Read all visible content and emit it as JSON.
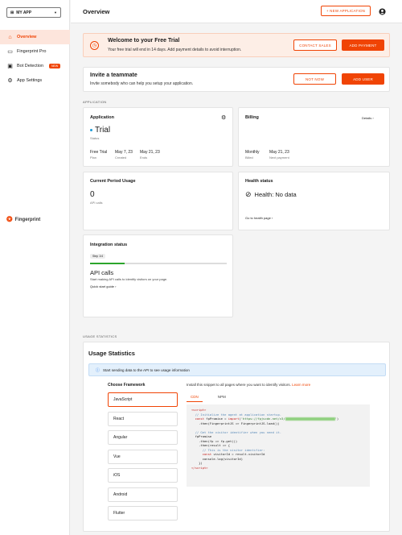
{
  "sidebar": {
    "app_select": "MY APP",
    "items": [
      {
        "label": "Overview",
        "icon": "home-icon"
      },
      {
        "label": "Fingerprint Pro",
        "icon": "monitor-icon"
      },
      {
        "label": "Bot Detection",
        "icon": "bot-icon",
        "badge": "NEW"
      },
      {
        "label": "App Settings",
        "icon": "gear-icon"
      }
    ],
    "logo": "Fingerprint"
  },
  "header": {
    "title": "Overview",
    "new_app": "+ NEW APPLICATION"
  },
  "trial": {
    "title": "Welcome to your Free Trial",
    "text": "Your free trial will end in 14 days. Add payment details to avoid interruption.",
    "contact": "CONTACT SALES",
    "add_payment": "ADD PAYMENT"
  },
  "invite": {
    "title": "Invite a teammate",
    "text": "Invite somebody who can help you setup your application.",
    "not_now": "NOT NOW",
    "add_user": "ADD USER"
  },
  "sections": {
    "application": "APPLICATION",
    "usage": "USAGE STATISTICS"
  },
  "app_card": {
    "title": "Application",
    "status": "Trial",
    "status_label": "Status",
    "meta": [
      {
        "value": "Free Trial",
        "label": "Plan"
      },
      {
        "value": "May 7, 23",
        "label": "Created"
      },
      {
        "value": "May 21, 23",
        "label": "Ends"
      }
    ]
  },
  "billing": {
    "title": "Billing",
    "details": "Details ›",
    "meta": [
      {
        "value": "Monthly",
        "label": "Billed"
      },
      {
        "value": "May 21, 23",
        "label": "Next payment"
      }
    ]
  },
  "usage_card": {
    "title": "Current Period Usage",
    "value": "0",
    "label": "API calls"
  },
  "health": {
    "title": "Health status",
    "status": "Health: No data",
    "link": "Go to health page ›"
  },
  "integration": {
    "title": "Integration status",
    "step": "Step 1/4",
    "progress": 0.25,
    "heading": "API calls",
    "text": "Start making API calls to identify visitors on your page.",
    "link": "Quick start guide ›"
  },
  "stats": {
    "title": "Usage Statistics",
    "info": "Start sending data to the API to see usage information",
    "choose": "Choose Framework",
    "frameworks": [
      "JavaScript",
      "React",
      "Angular",
      "Vue",
      "iOS",
      "Android",
      "Flutter"
    ],
    "note": "Install this snippet to all pages where you want to identify visitors.",
    "learn_more": "Learn more",
    "tabs": [
      "CDN",
      "NPM"
    ]
  },
  "colors": {
    "accent": "#f04405",
    "success": "#2ca52c",
    "info_bg": "#e3f0fc"
  }
}
